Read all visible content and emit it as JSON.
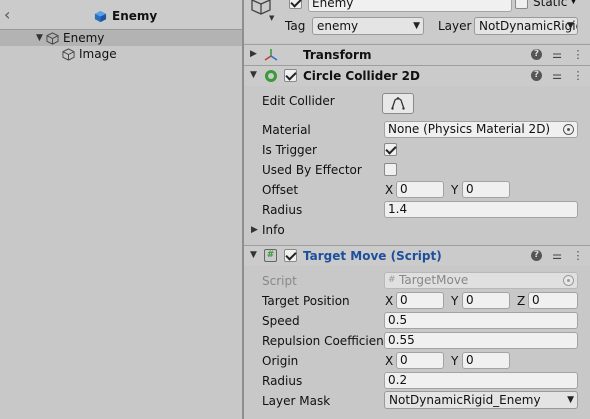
{
  "hierarchy": {
    "title": "Enemy",
    "items": [
      {
        "label": "Enemy"
      },
      {
        "label": "Image"
      }
    ]
  },
  "object": {
    "name": "Enemy",
    "static_label": "Static",
    "tag_label": "Tag",
    "tag_value": "enemy",
    "layer_label": "Layer",
    "layer_value": "NotDynamicRigid"
  },
  "transform": {
    "title": "Transform"
  },
  "circle_collider": {
    "title": "Circle Collider 2D",
    "edit_collider_label": "Edit Collider",
    "material_label": "Material",
    "material_value": "None (Physics Material 2D)",
    "is_trigger_label": "Is Trigger",
    "is_trigger": true,
    "used_by_effector_label": "Used By Effector",
    "used_by_effector": false,
    "offset_label": "Offset",
    "offset_x_label": "X",
    "offset_x": "0",
    "offset_y_label": "Y",
    "offset_y": "0",
    "radius_label": "Radius",
    "radius_value": "1.4",
    "info_label": "Info"
  },
  "target_move": {
    "title": "Target Move (Script)",
    "script_label": "Script",
    "script_value": "TargetMove",
    "target_position_label": "Target Position",
    "tp_x_label": "X",
    "tp_x": "0",
    "tp_y_label": "Y",
    "tp_y": "0",
    "tp_z_label": "Z",
    "tp_z": "0",
    "speed_label": "Speed",
    "speed_value": "0.5",
    "repulsion_label": "Repulsion Coefficient",
    "repulsion_value": "0.55",
    "origin_label": "Origin",
    "origin_x_label": "X",
    "origin_x": "0",
    "origin_y_label": "Y",
    "origin_y": "0",
    "radius_label": "Radius",
    "radius_value": "0.2",
    "layer_mask_label": "Layer Mask",
    "layer_mask_value": "NotDynamicRigid_Enemy"
  },
  "colors": {
    "panel_bg": "#c8c8c8",
    "selection": "#b3b3b3",
    "script_title": "#1d4f9c",
    "collider_icon": "#3a9a3a"
  }
}
